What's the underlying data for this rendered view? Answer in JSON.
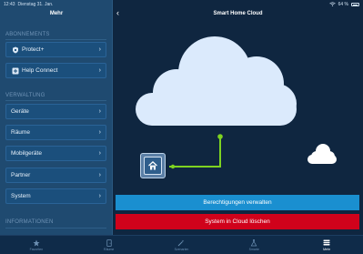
{
  "status": {
    "time": "12:43",
    "date": "Dienstag 31. Jan.",
    "battery": "64 %"
  },
  "sidebar": {
    "title": "Mehr",
    "sections": {
      "abos": "ABONNEMENTS",
      "verwaltung": "VERWALTUNG",
      "info": "INFORMATIONEN"
    },
    "items": [
      {
        "label": "Protect+",
        "icon": "shield-icon"
      },
      {
        "label": "Help Connect",
        "icon": "help-plus-icon"
      },
      {
        "label": "Geräte"
      },
      {
        "label": "Räume"
      },
      {
        "label": "Mobilgeräte"
      },
      {
        "label": "Partner"
      },
      {
        "label": "System"
      }
    ]
  },
  "main": {
    "title": "Smart Home Cloud",
    "primary_button": "Berechtigungen verwalten",
    "danger_button": "System in Cloud löschen",
    "colors": {
      "cloud": "#dbeafc",
      "connector": "#7ed321",
      "primary": "#1a8fd0",
      "danger": "#d0021b"
    }
  },
  "tabbar": {
    "tabs": [
      {
        "label": "Favoriten",
        "icon": "star-icon"
      },
      {
        "label": "Räume",
        "icon": "rooms-icon"
      },
      {
        "label": "Szenarien",
        "icon": "wand-icon"
      },
      {
        "label": "Smarte",
        "icon": "flask-icon"
      },
      {
        "label": "Mehr",
        "icon": "more-icon",
        "active": true
      }
    ]
  }
}
